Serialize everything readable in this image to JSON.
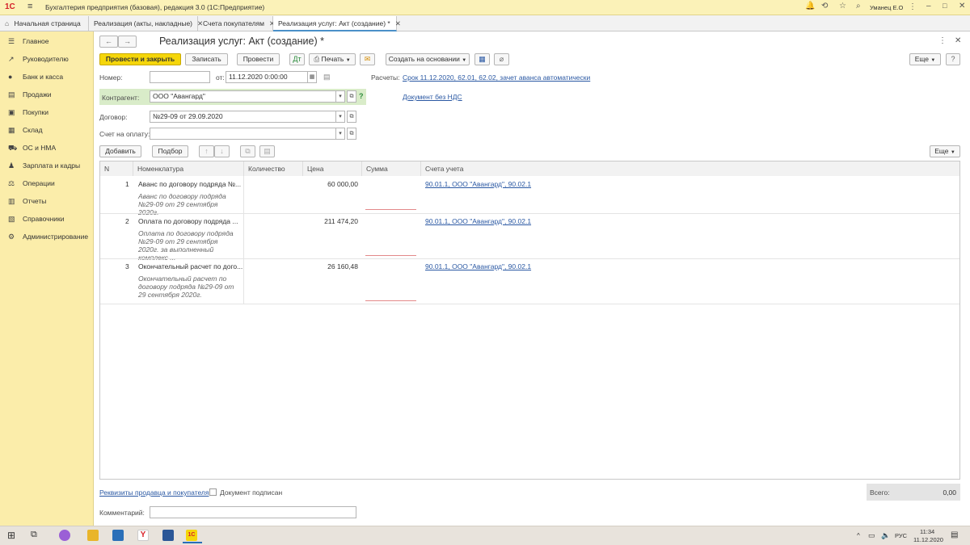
{
  "window": {
    "app_title": "Бухгалтерия предприятия (базовая), редакция 3.0  (1С:Предприятие)",
    "user": "Уманец Е.О"
  },
  "tabs": [
    {
      "label": "Начальная страница"
    },
    {
      "label": "Реализация (акты, накладные)"
    },
    {
      "label": "Счета покупателям"
    },
    {
      "label": "Реализация услуг: Акт (создание) *"
    }
  ],
  "sidebar": {
    "items": [
      {
        "label": "Главное",
        "icon": "menu-icon"
      },
      {
        "label": "Руководителю",
        "icon": "chart-icon"
      },
      {
        "label": "Банк и касса",
        "icon": "bank-icon"
      },
      {
        "label": "Продажи",
        "icon": "cart-icon"
      },
      {
        "label": "Покупки",
        "icon": "basket-icon"
      },
      {
        "label": "Склад",
        "icon": "warehouse-icon"
      },
      {
        "label": "ОС и НМА",
        "icon": "assets-icon"
      },
      {
        "label": "Зарплата и кадры",
        "icon": "people-icon"
      },
      {
        "label": "Операции",
        "icon": "operations-icon"
      },
      {
        "label": "Отчеты",
        "icon": "reports-icon"
      },
      {
        "label": "Справочники",
        "icon": "book-icon"
      },
      {
        "label": "Администрирование",
        "icon": "gear-icon"
      }
    ]
  },
  "document": {
    "title": "Реализация услуг: Акт (создание) *",
    "toolbar": {
      "post_close": "Провести и закрыть",
      "save": "Записать",
      "post": "Провести",
      "print": "Печать",
      "create_based": "Создать на основании",
      "more": "Еще"
    },
    "fields": {
      "number_label": "Номер:",
      "number_value": "",
      "date_label": "от:",
      "date_value": "11.12.2020  0:00:00",
      "settlements_label": "Расчеты:",
      "settlements_link": "Срок 11.12.2020, 62.01, 62.02, зачет аванса автоматически",
      "counterparty_label": "Контрагент:",
      "counterparty_value": "ООО \"Авангард\"",
      "vat_link": "Документ без НДС",
      "contract_label": "Договор:",
      "contract_value": "№29-09 от 29.09.2020",
      "invoice_label": "Счет на оплату:",
      "invoice_value": ""
    },
    "table_toolbar": {
      "add": "Добавить",
      "pick": "Подбор",
      "more": "Еще"
    },
    "table": {
      "headers": [
        "N",
        "Номенклатура",
        "Количество",
        "Цена",
        "Сумма",
        "Счета учета"
      ],
      "rows": [
        {
          "n": "1",
          "item": "Аванс по договору подряда №...",
          "content": "Аванс по договору подряда №29-09 от 29 сентября 2020г.",
          "qty": "",
          "price": "60 000,00",
          "sum": "",
          "accounts": "90.01.1, ООО \"Авангард\", 90.02.1"
        },
        {
          "n": "2",
          "item": "Оплата по договору подряда ...",
          "content": "Оплата по договору подряда №29-09 от 29 сентября 2020г. за выполненный комплекс ...",
          "qty": "",
          "price": "211 474,20",
          "sum": "",
          "accounts": "90.01.1, ООО \"Авангард\", 90.02.1"
        },
        {
          "n": "3",
          "item": "Окончательный расчет по дого...",
          "content": "Окончательный расчет по договору подряда №29-09 от 29 сентября 2020г.",
          "qty": "",
          "price": "26 160,48",
          "sum": "",
          "accounts": "90.01.1, ООО \"Авангард\", 90.02.1"
        }
      ]
    },
    "footer": {
      "requisites_link": "Реквизиты продавца и покупателя",
      "signed_label": "Документ подписан",
      "total_label": "Всего:",
      "total_value": "0,00",
      "comment_label": "Комментарий:",
      "comment_value": ""
    }
  },
  "taskbar": {
    "lang": "РУС",
    "time": "11:34",
    "date": "11.12.2020"
  },
  "colors": {
    "sidebar_bg": "#fbedaa",
    "primary_button": "#f5d60a",
    "link": "#2a58a3"
  }
}
